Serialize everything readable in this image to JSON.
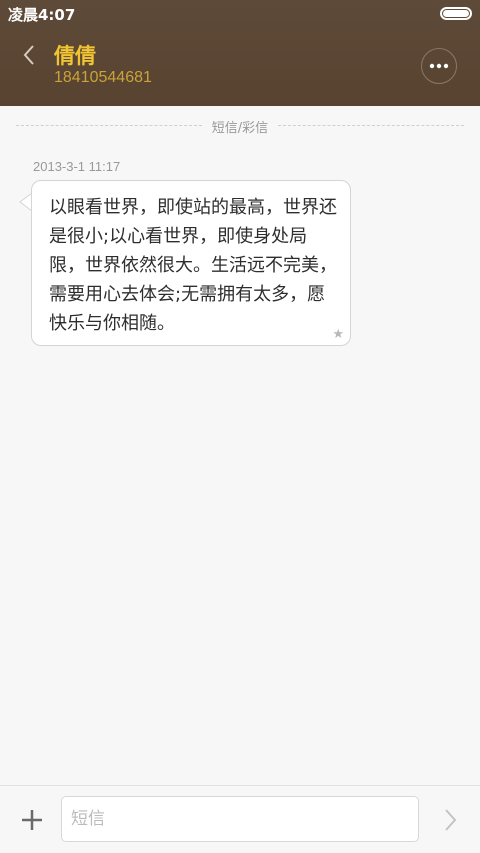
{
  "status_bar": {
    "time": "凌晨4:07"
  },
  "header": {
    "contact_name": "倩倩",
    "contact_number": "18410544681",
    "back_icon": "chevron-left-icon",
    "more_icon": "more-dots-icon"
  },
  "conversation": {
    "divider_label": "短信/彩信",
    "messages": [
      {
        "timestamp": "2013-3-1 11:17",
        "text": "以眼看世界，即使站的最高，世界还是很小;以心看世界，即使身处局限，世界依然很大。生活远不完美，需要用心去体会;无需拥有太多，愿快乐与你相随。",
        "starred_icon": "star-icon"
      }
    ]
  },
  "composer": {
    "placeholder": "短信",
    "value": "",
    "add_icon": "plus-icon",
    "send_icon": "chevron-right-icon"
  },
  "colors": {
    "header_bg": "#57432f",
    "accent_name": "#f0c432",
    "accent_number": "#c9a43a",
    "background": "#f7f7f7"
  }
}
